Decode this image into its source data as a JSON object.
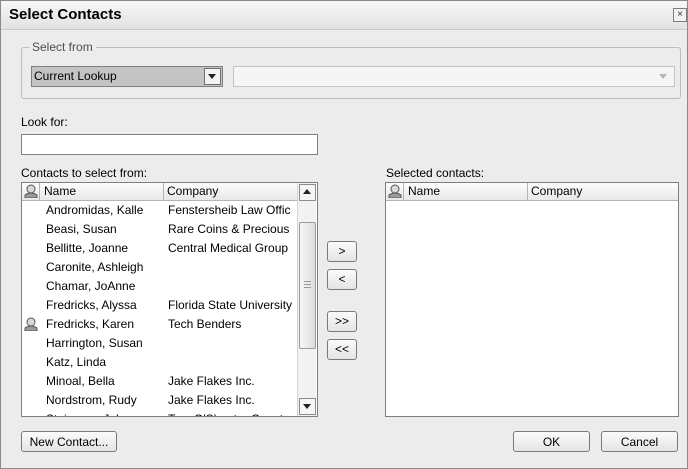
{
  "dialog": {
    "title": "Select Contacts",
    "close_glyph": "×"
  },
  "select_from": {
    "legend": "Select from",
    "lookup_value": "Current Lookup",
    "secondary_value": ""
  },
  "look_for": {
    "label": "Look for:",
    "value": ""
  },
  "available": {
    "label": "Contacts to select from:",
    "columns": [
      "Name",
      "Company"
    ],
    "rows": [
      {
        "name": "Andromidas, Kalle",
        "company": "Fenstersheib Law Offic",
        "has_icon": false
      },
      {
        "name": "Beasi, Susan",
        "company": "Rare Coins & Precious",
        "has_icon": false
      },
      {
        "name": "Bellitte, Joanne",
        "company": "Central Medical Group",
        "has_icon": false
      },
      {
        "name": "Caronite, Ashleigh",
        "company": "",
        "has_icon": false
      },
      {
        "name": "Chamar, JoAnne",
        "company": "",
        "has_icon": false
      },
      {
        "name": "Fredricks, Alyssa",
        "company": "Florida State University",
        "has_icon": false
      },
      {
        "name": "Fredricks, Karen",
        "company": "Tech Benders",
        "has_icon": true
      },
      {
        "name": "Harrington, Susan",
        "company": "",
        "has_icon": false
      },
      {
        "name": "Katz, Linda",
        "company": "",
        "has_icon": false
      },
      {
        "name": "Minoal, Bella",
        "company": "Jake Flakes Inc.",
        "has_icon": false
      },
      {
        "name": "Nordstrom, Rudy",
        "company": "Jake Flakes Inc.",
        "has_icon": false
      },
      {
        "name": "Steinman, John",
        "company": "Tam O'Shanter Country",
        "has_icon": false
      }
    ]
  },
  "selected": {
    "label": "Selected contacts:",
    "columns": [
      "Name",
      "Company"
    ],
    "rows": []
  },
  "move_buttons": {
    "add": ">",
    "remove": "<",
    "add_all": ">>",
    "remove_all": "<<"
  },
  "footer": {
    "new_contact": "New Contact...",
    "ok": "OK",
    "cancel": "Cancel"
  },
  "icons": {
    "column_header": "contact-type-icon",
    "row_marker": "my-record-icon",
    "close": "close-icon",
    "dropdown": "chevron-down-icon"
  }
}
